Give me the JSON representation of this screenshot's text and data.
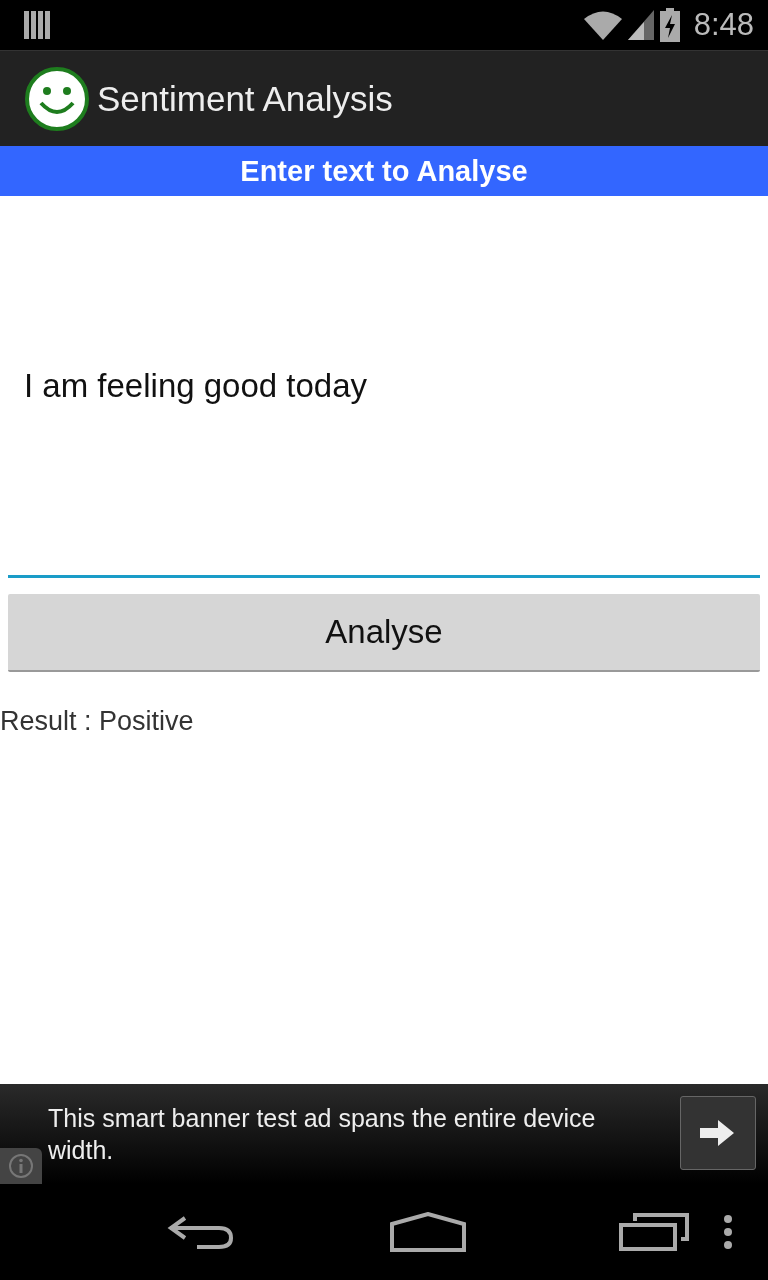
{
  "status_bar": {
    "time": "8:48"
  },
  "action_bar": {
    "title": "Sentiment Analysis"
  },
  "header": {
    "text": "Enter text to Analyse"
  },
  "input": {
    "value": "I am feeling good today"
  },
  "analyse_button": {
    "label": "Analyse"
  },
  "result": {
    "text": "Result : Positive"
  },
  "ad_banner": {
    "text": "This smart banner test ad spans the entire device width."
  }
}
